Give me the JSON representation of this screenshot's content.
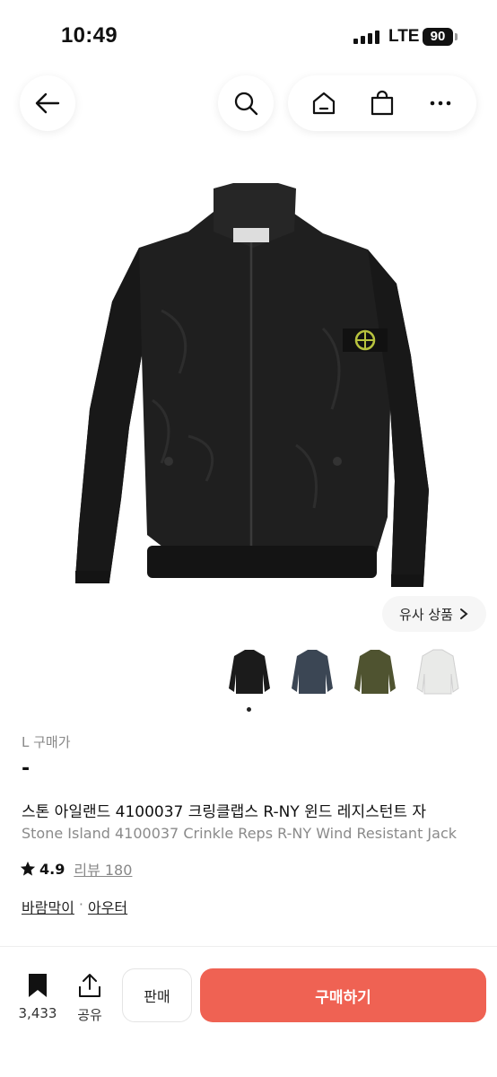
{
  "status_bar": {
    "time": "10:49",
    "network": "LTE",
    "battery": "90"
  },
  "nav": {
    "back_icon": "arrow-left-icon",
    "search_icon": "search-icon",
    "home_icon": "home-icon",
    "bag_icon": "shopping-bag-icon",
    "more_icon": "more-icon"
  },
  "product": {
    "image_desc_icon": "jacket-image",
    "similar_label": "유사 상품",
    "colors": [
      "black",
      "navy",
      "olive",
      "white"
    ],
    "size_label": "L 구매가",
    "price": "-",
    "title_ko": "스톤 아일랜드 4100037 크링클랩스 R-NY 윈드 레지스턴트 자",
    "title_en": "Stone Island 4100037 Crinkle Reps R-NY Wind Resistant Jack",
    "rating": "4.9",
    "review_label": "리뷰 180",
    "categories": [
      "바람막이",
      "아우터"
    ],
    "category_separator": "·"
  },
  "bottom": {
    "bookmark_count": "3,433",
    "share_label": "공유",
    "sell_label": "판매",
    "buy_label": "구매하기"
  },
  "colors": {
    "buy_button": "#ef6253"
  }
}
